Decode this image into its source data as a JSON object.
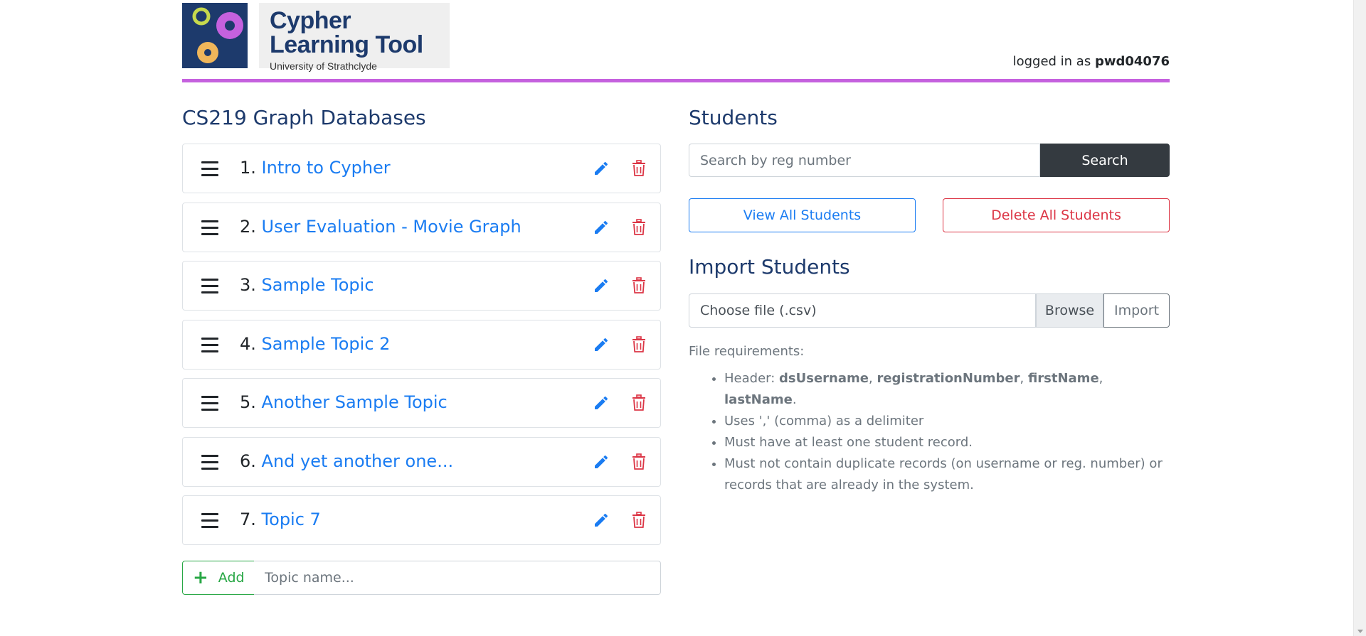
{
  "header": {
    "logo_title_line1": "Cypher",
    "logo_title_line2": "Learning Tool",
    "logo_subtitle": "University of Strathclyde",
    "login_prefix": "logged in as",
    "username": "pwd04076"
  },
  "course": {
    "title": "CS219 Graph Databases",
    "topics": [
      {
        "num": "1.",
        "name": "Intro to Cypher"
      },
      {
        "num": "2.",
        "name": "User Evaluation - Movie Graph"
      },
      {
        "num": "3.",
        "name": "Sample Topic"
      },
      {
        "num": "4.",
        "name": "Sample Topic 2"
      },
      {
        "num": "5.",
        "name": "Another Sample Topic"
      },
      {
        "num": "6.",
        "name": "And yet another one..."
      },
      {
        "num": "7.",
        "name": "Topic 7"
      }
    ],
    "add_label": "Add",
    "topic_placeholder": "Topic name..."
  },
  "students": {
    "title": "Students",
    "search_placeholder": "Search by reg number",
    "search_label": "Search",
    "view_all_label": "View All Students",
    "delete_all_label": "Delete All Students"
  },
  "import": {
    "title": "Import Students",
    "file_label": "Choose file (.csv)",
    "browse_label": "Browse",
    "import_label": "Import",
    "req_title": "File requirements:",
    "req_header_prefix": "Header:",
    "req_header_fields": [
      "dsUsername",
      "registrationNumber",
      "firstName",
      "lastName"
    ],
    "req_items": [
      "Uses ',' (comma) as a delimiter",
      "Must have at least one student record.",
      "Must not contain duplicate records (on username or reg. number) or records that are already in the system."
    ]
  },
  "colors": {
    "brand_navy": "#1d3a6c",
    "accent_purple": "#c561de",
    "link_blue": "#1a7cf2",
    "danger_red": "#dc3545",
    "success_green": "#28a745",
    "dark_button": "#343a40"
  }
}
